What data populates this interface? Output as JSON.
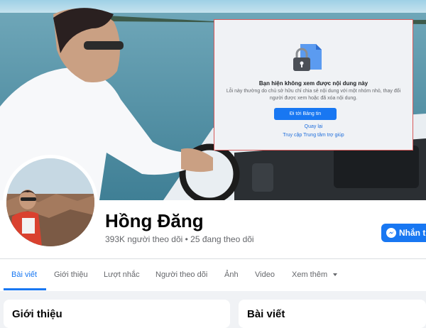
{
  "overlay": {
    "title": "Bạn hiện không xem được nội dung này",
    "message": "Lỗi này thường do chủ sở hữu chỉ chia sẻ nội dung với một nhóm nhỏ, thay đổi người được xem hoặc đã xóa nội dung.",
    "primary_button": "Đi tới Bảng tin",
    "back_link": "Quay lại",
    "help_link": "Truy cập Trung tâm trợ giúp",
    "icon": "lock-icon"
  },
  "profile": {
    "name": "Hồng Đăng",
    "follow_stats": "393K người theo dõi • 25 đang theo dõi",
    "message_button": "Nhắn tin"
  },
  "tabs": [
    {
      "label": "Bài viết"
    },
    {
      "label": "Giới thiệu"
    },
    {
      "label": "Lượt nhắc"
    },
    {
      "label": "Người theo dõi"
    },
    {
      "label": "Ảnh"
    },
    {
      "label": "Video"
    },
    {
      "label": "Xem thêm"
    }
  ],
  "cards": {
    "intro_title": "Giới thiệu",
    "posts_title": "Bài viết"
  },
  "colors": {
    "accent": "#1877f2",
    "link": "#216fdb"
  }
}
